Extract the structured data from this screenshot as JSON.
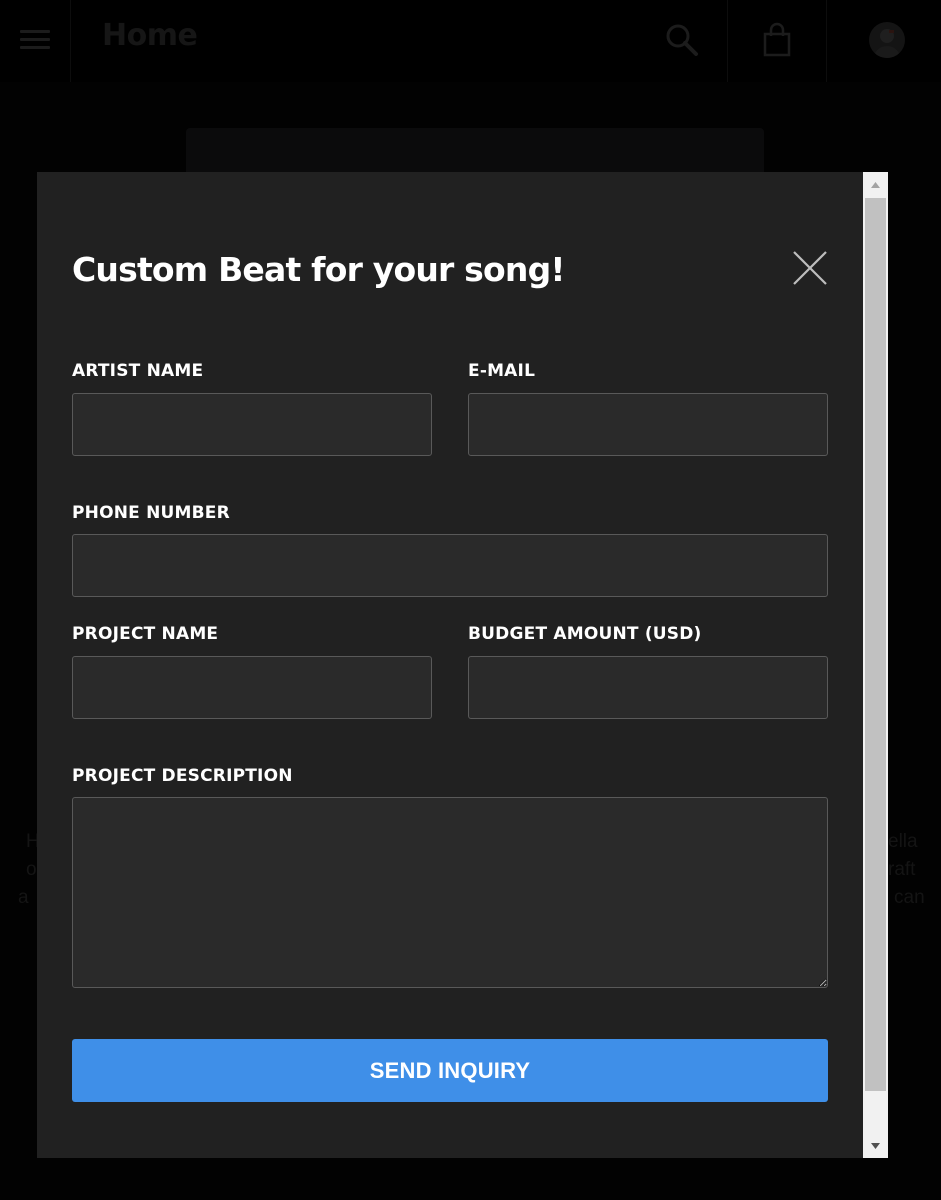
{
  "header": {
    "title": "Home",
    "menu_icon": "hamburger-menu-icon",
    "search_icon": "search-icon",
    "cart_icon": "shopping-bag-icon",
    "avatar_icon": "user-avatar"
  },
  "background": {
    "left_fragments": [
      "H",
      "o",
      "a"
    ],
    "right_fragments": [
      "ella",
      "raft",
      "can"
    ]
  },
  "modal": {
    "title": "Custom Beat for your song!",
    "close_icon": "close-icon",
    "fields": {
      "artist_name": {
        "label": "ARTIST NAME",
        "value": "",
        "placeholder": ""
      },
      "email": {
        "label": "E-MAIL",
        "value": "",
        "placeholder": ""
      },
      "phone_number": {
        "label": "PHONE NUMBER",
        "value": "",
        "placeholder": ""
      },
      "project_name": {
        "label": "PROJECT NAME",
        "value": "",
        "placeholder": ""
      },
      "budget_amount": {
        "label": "BUDGET AMOUNT (USD)",
        "value": "",
        "placeholder": ""
      },
      "project_description": {
        "label": "PROJECT DESCRIPTION",
        "value": "",
        "placeholder": ""
      }
    },
    "submit_label": "SEND INQUIRY"
  },
  "colors": {
    "modal_background": "#212121",
    "input_background": "#2a2a2a",
    "input_border": "#595959",
    "button_accent": "#3f8fe8",
    "text_primary": "#ffffff"
  }
}
